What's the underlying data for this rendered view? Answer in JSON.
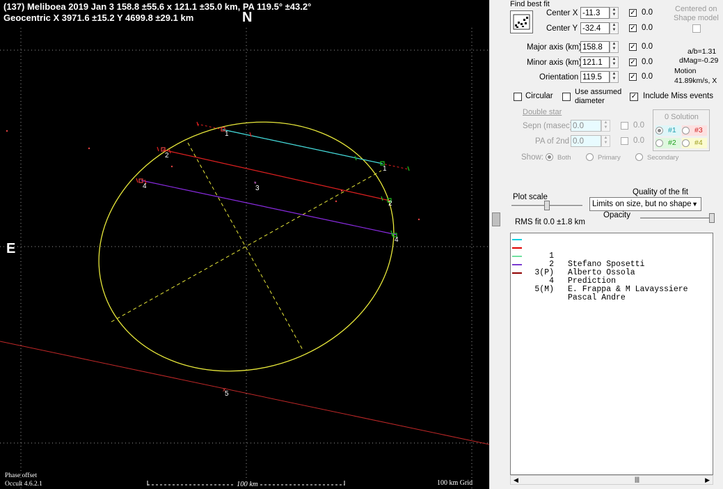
{
  "plot": {
    "title_line1": "(137) Meliboea  2019 Jan 3   158.8 ±55.6 x 121.1 ±35.0 km, PA 119.5° ±43.2°",
    "title_line2": "Geocentric  X  3971.6 ±15.2  Y 4699.8 ±29.1 km",
    "north_label": "N",
    "east_label": "E",
    "phase_offset": "Phase offset",
    "version": "Occult 4.6.2.1",
    "scale_label": "100 km",
    "grid_label": "100 km Grid",
    "chord_labels": [
      "1",
      "1",
      "2",
      "2",
      "3",
      "4",
      "4",
      "5"
    ]
  },
  "colors": {
    "ellipse": "#e8e83a",
    "chord1": "#40e0e0",
    "chord2": "#e02020",
    "chord4": "#8a2be2",
    "chord5": "#c02828"
  },
  "panel": {
    "find_best_fit": "Find best fit",
    "center_x_label": "Center X",
    "center_x_value": "-11.3",
    "center_y_label": "Center Y",
    "center_y_value": "-32.4",
    "major_label": "Major axis (km)",
    "major_value": "158.8",
    "minor_label": "Minor axis (km)",
    "minor_value": "121.1",
    "orient_label": "Orientation",
    "orient_value": "119.5",
    "zero": "0.0",
    "centered_on": "Centered on",
    "shape_model": "Shape model",
    "ab_ratio": "a/b=1.31",
    "dmag": "dMag=-0.29",
    "motion": "Motion",
    "motion_val": "41.89km/s, X",
    "circular": "Circular",
    "use_assumed": "Use assumed",
    "diameter": "diameter",
    "include_miss": "Include Miss events",
    "double_star": "Double star",
    "sepn_label": "Sepn (masec)",
    "sepn_value": "0.0",
    "pa2_label": "PA of 2nd",
    "pa2_value": "0.0",
    "show_label": "Show:",
    "both": "Both",
    "primary": "Primary",
    "secondary": "Secondary",
    "solution": "0 Solution",
    "sol1": "#1",
    "sol2": "#2",
    "sol3": "#3",
    "sol4": "#4",
    "plot_scale": "Plot scale",
    "quality_label": "Quality of the fit",
    "quality_value": "Limits on size, but no shape",
    "opacity": "Opacity",
    "rms_fit": "RMS fit  0.0 ±1.8 km"
  },
  "legend": [
    {
      "idx": "1",
      "name": "Stefano Sposetti",
      "color": "#00d0e0"
    },
    {
      "idx": "2",
      "name": "Alberto Ossola",
      "color": "#e00000"
    },
    {
      "idx": "3(P)",
      "name": "Prediction",
      "color": "#70e0a0"
    },
    {
      "idx": "4",
      "name": "E. Frappa & M Lavayssiere",
      "color": "#7a3ad0"
    },
    {
      "idx": "5(M)",
      "name": "Pascal Andre",
      "color": "#900000"
    }
  ]
}
